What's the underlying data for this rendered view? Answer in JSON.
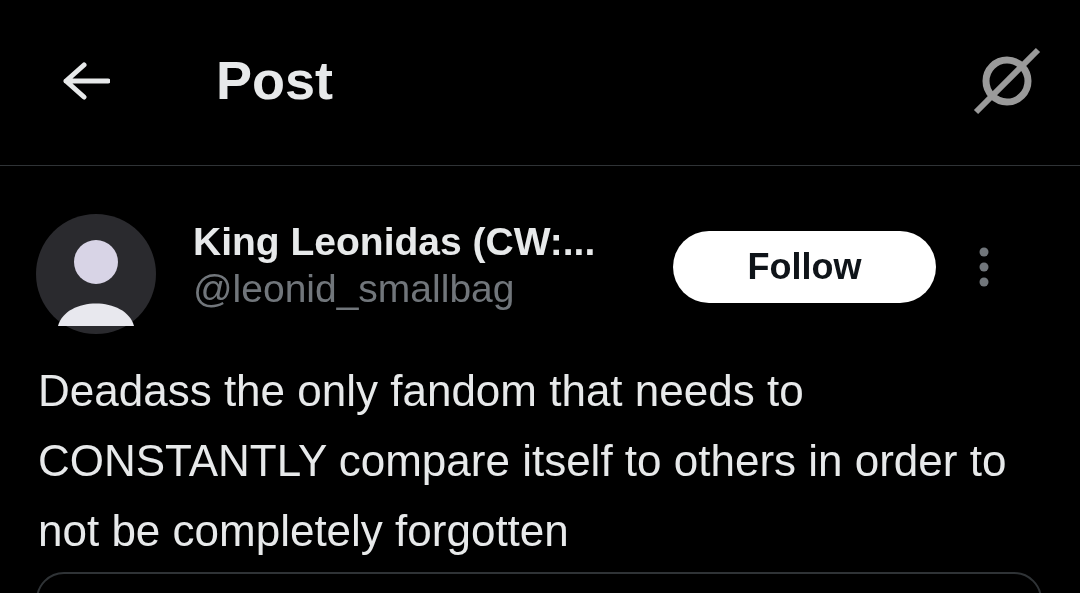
{
  "header": {
    "title": "Post"
  },
  "post": {
    "author": {
      "name": "King Leonidas (CW:...",
      "handle": "@leonid_smallbag"
    },
    "follow_button": "Follow",
    "text": "Deadass the only fandom that needs to CONSTANTLY compare itself to others in order to not be completely forgotten",
    "attachment": {
      "kind": "card"
    }
  }
}
